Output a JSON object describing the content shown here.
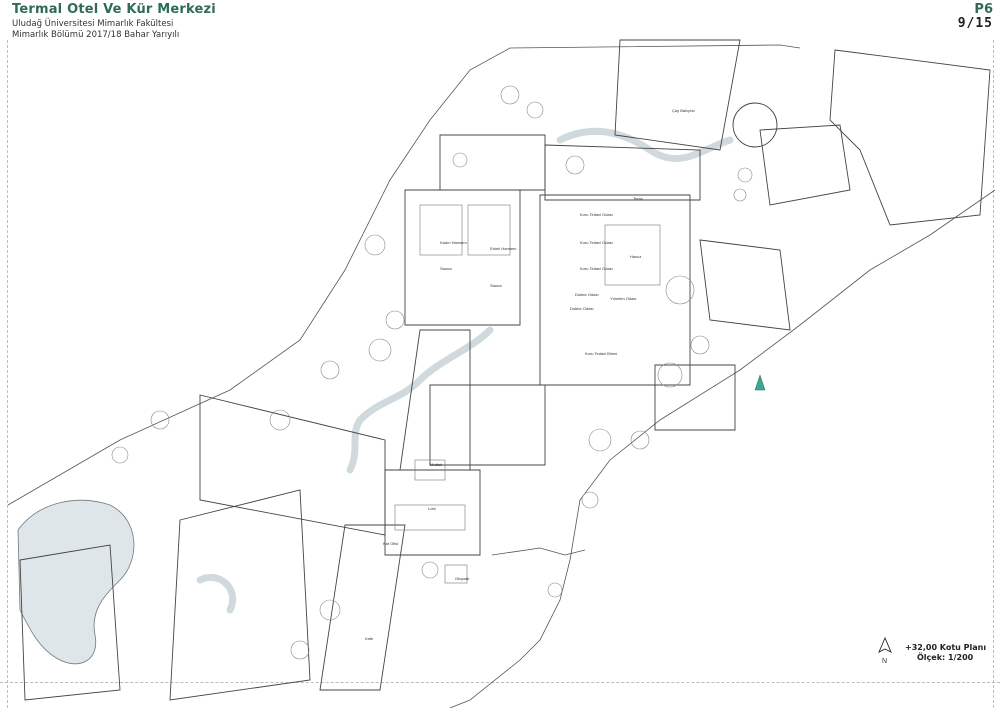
{
  "header": {
    "title": "Termal Otel Ve Kür Merkezi",
    "university": "Uludağ Üniversitesi Mimarlık Fakültesi",
    "semester": "Mimarlık Bölümü 2017/18 Bahar Yarıyılı",
    "sheet_code": "P6",
    "sheet_number": "9/15"
  },
  "legend": {
    "plan_title": "+32,00 Kotu Planı",
    "scale": "Ölçek: 1/200",
    "north_label": "N"
  },
  "rooms": [
    "Çay Bahçesi",
    "Teras",
    "Kuru Tedavi Odası",
    "Kuru Tedavi Odası",
    "Kadın Hamamı",
    "Erkek Hamamı",
    "Sauna",
    "Sauna",
    "Kuru Tedavi Odası",
    "Doktor Odası",
    "Doktor Odası",
    "Havuz",
    "Yönetim Odası",
    "Kuru Tedavi Birimi",
    "Mutfak",
    "Lobi",
    "Kat Ofisi",
    "Kafe",
    "Otopark"
  ],
  "colors": {
    "title": "#2f6b58",
    "north_arrow": "#3aa893",
    "line": "#555555",
    "water": "#dfe6ea"
  }
}
